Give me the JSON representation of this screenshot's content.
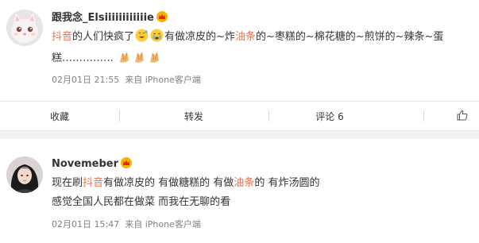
{
  "post1": {
    "username": "跟我念_Elsiiiiiiiiiiiie",
    "content": {
      "hashtag": "抖音",
      "text1": "的人们快疯了",
      "text2": "有做凉皮的~炸",
      "red1": "油条",
      "text3": "的~枣糕的~棉花糖的~煎饼的~辣条~蛋",
      "text4": "糕……………"
    },
    "emojis": [
      "sweat-smile-emoji",
      "crying-emoji"
    ],
    "clap_count": 3,
    "timestamp": "02月01日 21:55",
    "source": "来自 iPhone客户端"
  },
  "actions": {
    "favorite": "收藏",
    "repost": "转发",
    "comment": "评论 6",
    "like_icon": "thumbs-up-icon"
  },
  "post2": {
    "username": "Novemeber",
    "content": {
      "line1_a": "现在刷",
      "line1_red_a": "抖音",
      "line1_b": "有做凉皮的  有做糖糕的  有做",
      "line1_red_b": "油条",
      "line1_c": "的  有炸汤圆的",
      "line2": "感觉全国人民都在做菜  而我在无聊的看"
    },
    "timestamp": "02月01日 15:47",
    "source": "来自 iPhone客户端"
  },
  "colors": {
    "accent": "#eb7350",
    "crown": "#f4b400",
    "meta": "#808080",
    "divider": "#e6e6e6"
  }
}
